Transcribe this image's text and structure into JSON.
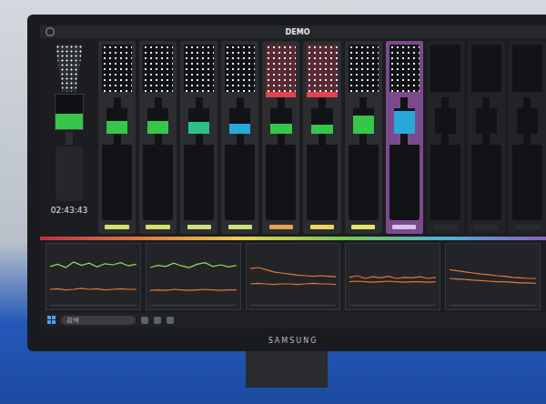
{
  "window": {
    "title": "DEMO"
  },
  "overview": {
    "time": "02:43:43",
    "level": 0.45,
    "color": "#35c64a"
  },
  "columns": [
    {
      "active": true,
      "alert": false,
      "selected": false,
      "level": 0.5,
      "color": "#35c64a",
      "labelColor": "#d6e06a"
    },
    {
      "active": true,
      "alert": false,
      "selected": false,
      "level": 0.5,
      "color": "#35c64a",
      "labelColor": "#d6e06a"
    },
    {
      "active": true,
      "alert": false,
      "selected": false,
      "level": 0.45,
      "color": "#2fc08a",
      "labelColor": "#cfe07a"
    },
    {
      "active": true,
      "alert": false,
      "selected": false,
      "level": 0.4,
      "color": "#2aa8d8",
      "labelColor": "#cfe07a"
    },
    {
      "active": true,
      "alert": true,
      "selected": false,
      "level": 0.4,
      "color": "#35c64a",
      "labelColor": "#e8a24a"
    },
    {
      "active": true,
      "alert": true,
      "selected": false,
      "level": 0.35,
      "color": "#35c64a",
      "labelColor": "#f0d25a"
    },
    {
      "active": true,
      "alert": false,
      "selected": false,
      "level": 0.7,
      "color": "#35c64a",
      "labelColor": "#e9e36a"
    },
    {
      "active": true,
      "alert": false,
      "selected": true,
      "level": 0.9,
      "color": "#2aa8d8",
      "labelColor": "#d9c2ea"
    },
    {
      "active": false,
      "alert": false,
      "selected": false,
      "level": 0,
      "color": "#2a2b2f",
      "labelColor": "#2a2b2f"
    },
    {
      "active": false,
      "alert": false,
      "selected": false,
      "level": 0,
      "color": "#2a2b2f",
      "labelColor": "#2a2b2f"
    },
    {
      "active": false,
      "alert": false,
      "selected": false,
      "level": 0,
      "color": "#2a2b2f",
      "labelColor": "#2a2b2f"
    }
  ],
  "charts": [
    {
      "series": [
        {
          "color": "#8fe05a",
          "values": [
            72,
            76,
            70,
            80,
            74,
            78,
            71,
            77,
            75,
            79,
            73,
            76
          ]
        },
        {
          "color": "#e0783a",
          "values": [
            30,
            31,
            29,
            30,
            32,
            30,
            31,
            29,
            30,
            31,
            30,
            30
          ]
        }
      ]
    },
    {
      "series": [
        {
          "color": "#8fe05a",
          "values": [
            70,
            74,
            72,
            78,
            73,
            70,
            76,
            79,
            72,
            75,
            71,
            74
          ]
        },
        {
          "color": "#e0783a",
          "values": [
            28,
            29,
            28,
            30,
            29,
            28,
            29,
            30,
            29,
            28,
            29,
            29
          ]
        }
      ]
    },
    {
      "series": [
        {
          "color": "#e0783a",
          "values": [
            68,
            70,
            66,
            62,
            60,
            58,
            56,
            55,
            54,
            55,
            54,
            53
          ]
        },
        {
          "color": "#e0783a",
          "values": [
            40,
            41,
            40,
            39,
            40,
            40,
            39,
            40,
            41,
            40,
            40,
            39
          ]
        }
      ]
    },
    {
      "series": [
        {
          "color": "#e0783a",
          "values": [
            52,
            55,
            50,
            53,
            51,
            54,
            50,
            52,
            51,
            53,
            50,
            52
          ]
        },
        {
          "color": "#e0783a",
          "values": [
            44,
            45,
            44,
            43,
            44,
            45,
            44,
            43,
            44,
            44,
            43,
            44
          ]
        }
      ]
    },
    {
      "series": [
        {
          "color": "#e0783a",
          "values": [
            66,
            64,
            62,
            60,
            58,
            57,
            55,
            54,
            52,
            51,
            50,
            50
          ]
        },
        {
          "color": "#e0783a",
          "values": [
            50,
            49,
            48,
            47,
            46,
            45,
            44,
            44,
            43,
            42,
            42,
            41
          ]
        }
      ]
    }
  ],
  "taskbar": {
    "search": "검색"
  },
  "monitor": {
    "brand": "SAMSUNG"
  }
}
